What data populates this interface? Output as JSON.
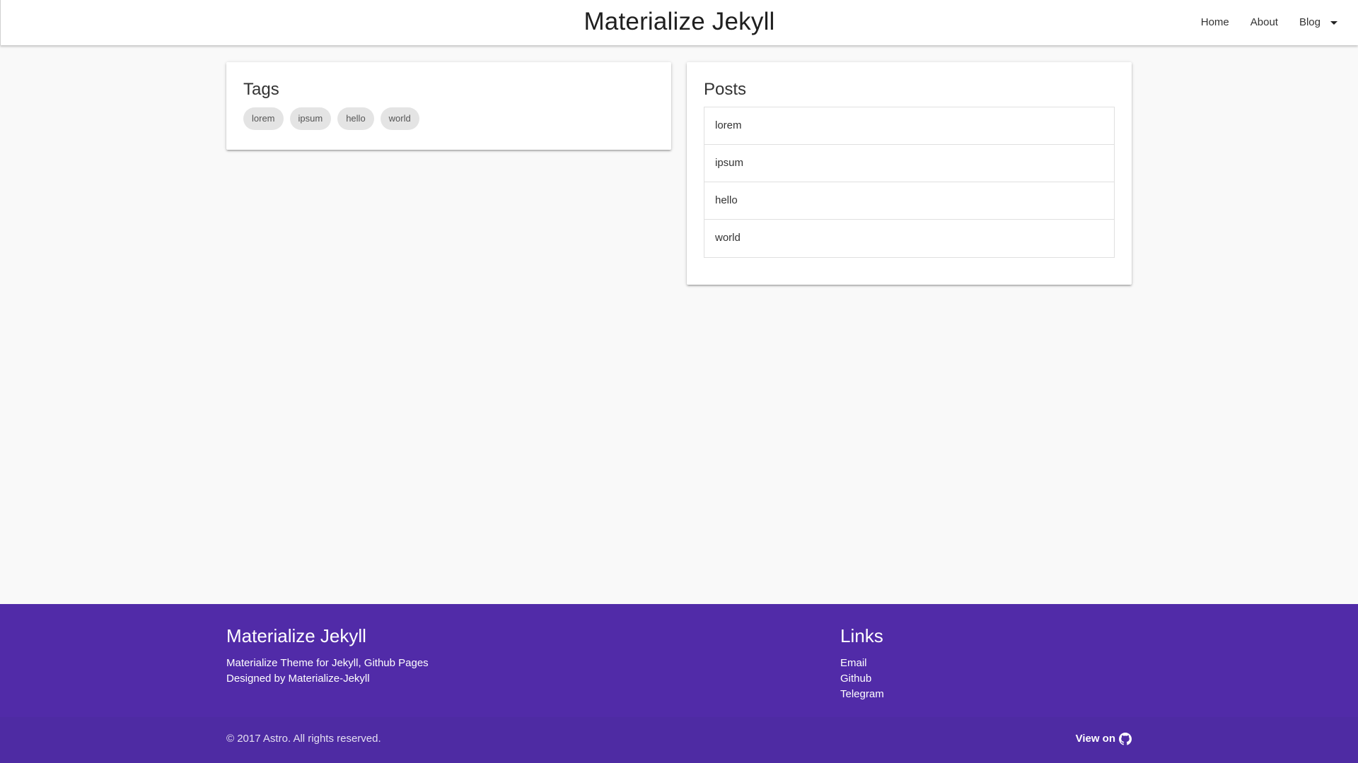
{
  "navbar": {
    "brand": "Materialize Jekyll",
    "links": [
      {
        "label": "Home"
      },
      {
        "label": "About"
      },
      {
        "label": "Blog"
      }
    ]
  },
  "tags_card": {
    "title": "Tags",
    "chips": [
      "lorem",
      "ipsum",
      "hello",
      "world"
    ]
  },
  "posts_card": {
    "title": "Posts",
    "items": [
      "lorem",
      "ipsum",
      "hello",
      "world"
    ]
  },
  "footer": {
    "title": "Materialize Jekyll",
    "lines": [
      "Materialize Theme for Jekyll, Github Pages",
      "Designed by Materialize-Jekyll"
    ],
    "links_title": "Links",
    "links": [
      "Email",
      "Github",
      "Telegram"
    ],
    "copyright": "© 2017 Astro. All rights reserved.",
    "view_on": "View on",
    "view_on_icon": "github-icon"
  },
  "colors": {
    "footer_bg": "#512ba8",
    "background": "#f9f9f9",
    "chip_bg": "#e4e4e4"
  }
}
